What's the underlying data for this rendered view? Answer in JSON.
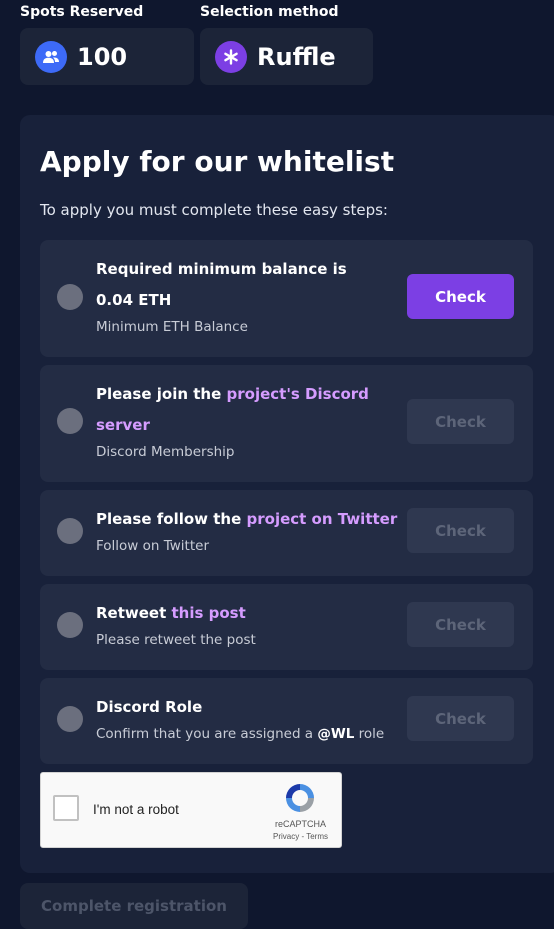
{
  "stats": [
    {
      "label": "Spots Reserved",
      "value": "100",
      "icon": "users-icon",
      "icon_color": "#3d6af7"
    },
    {
      "label": "Selection method",
      "value": "Ruffle",
      "icon": "asterisk-icon",
      "icon_color": "#7c3fe4"
    }
  ],
  "panel": {
    "title": "Apply for our whitelist",
    "subtitle": "To apply you must complete these easy steps:"
  },
  "steps": [
    {
      "title_text": "Required minimum balance is 0.04 ETH",
      "desc": "Minimum ETH Balance",
      "button": "Check",
      "button_state": "active"
    },
    {
      "title_text": "Please join the ",
      "title_link": "project's Discord server",
      "desc": "Discord Membership",
      "button": "Check",
      "button_state": "disabled"
    },
    {
      "title_text": "Please follow the ",
      "title_link": "project on Twitter",
      "desc": "Follow on Twitter",
      "button": "Check",
      "button_state": "disabled"
    },
    {
      "title_text": "Retweet ",
      "title_link": "this post",
      "desc": "Please retweet the post",
      "button": "Check",
      "button_state": "disabled"
    },
    {
      "title_text": "Discord Role",
      "desc_prefix": "Confirm that you are assigned a ",
      "desc_bold": "@WL",
      "desc_suffix": " role",
      "button": "Check",
      "button_state": "disabled"
    }
  ],
  "captcha": {
    "label": "I'm not a robot",
    "brand": "reCAPTCHA",
    "privacy": "Privacy",
    "separator": " - ",
    "terms": "Terms"
  },
  "footer": {
    "complete_button": "Complete registration"
  },
  "colors": {
    "background": "#0f172e",
    "panel": "#18213a",
    "card": "#232c44",
    "accent": "#7c3fe4",
    "link": "#d59cff"
  }
}
